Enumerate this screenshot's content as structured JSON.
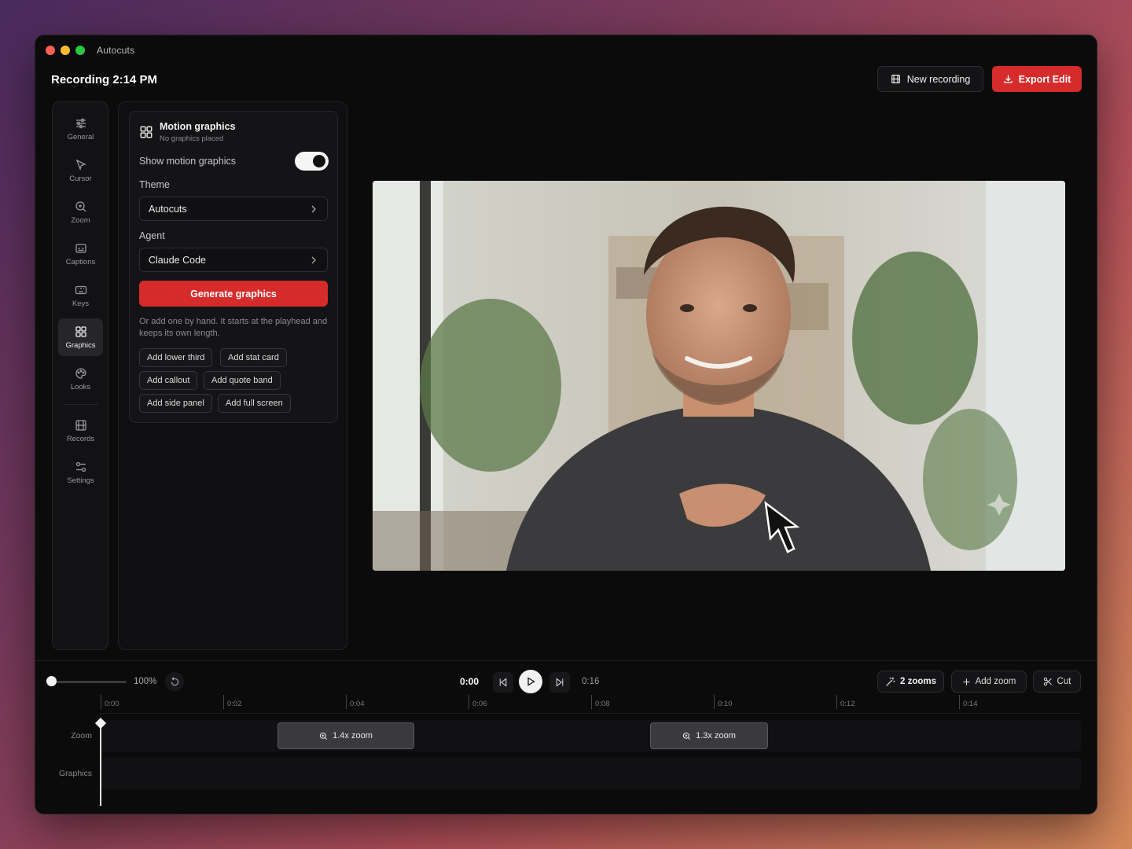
{
  "app": {
    "name": "Autocuts"
  },
  "header": {
    "title": "Recording 2:14 PM",
    "new_recording_label": "New recording",
    "export_label": "Export Edit",
    "accent_color": "#d62b2b"
  },
  "rail": {
    "items": [
      {
        "label": "General",
        "icon": "sliders-icon"
      },
      {
        "label": "Cursor",
        "icon": "cursor-icon"
      },
      {
        "label": "Zoom",
        "icon": "zoom-in-icon"
      },
      {
        "label": "Captions",
        "icon": "captions-icon"
      },
      {
        "label": "Keys",
        "icon": "keyboard-icon"
      },
      {
        "label": "Graphics",
        "icon": "grid-icon",
        "active": true
      },
      {
        "label": "Looks",
        "icon": "palette-icon"
      },
      {
        "label": "Records",
        "icon": "film-icon"
      },
      {
        "label": "Settings",
        "icon": "settings-icon"
      }
    ]
  },
  "panel": {
    "title": "Motion graphics",
    "subtitle": "No graphics placed",
    "show_label": "Show motion graphics",
    "show_enabled": true,
    "theme_label": "Theme",
    "theme_value": "Autocuts",
    "agent_label": "Agent",
    "agent_value": "Claude Code",
    "generate_label": "Generate graphics",
    "hint": "Or add one by hand. It starts at the playhead and keeps its own length.",
    "chips": [
      "Add lower third",
      "Add stat card",
      "Add callout",
      "Add quote band",
      "Add side panel",
      "Add full screen"
    ]
  },
  "timeline": {
    "zoom_percent": "100%",
    "current_time": "0:00",
    "end_time": "0:16",
    "zooms_label": "2 zooms",
    "add_zoom_label": "Add zoom",
    "cut_label": "Cut",
    "ticks": [
      "0:00",
      "0:02",
      "0:04",
      "0:06",
      "0:08",
      "0:10",
      "0:12",
      "0:14"
    ],
    "tracks": [
      "Zoom",
      "Graphics"
    ],
    "clips": [
      "1.4x zoom",
      "1.3x zoom"
    ]
  }
}
